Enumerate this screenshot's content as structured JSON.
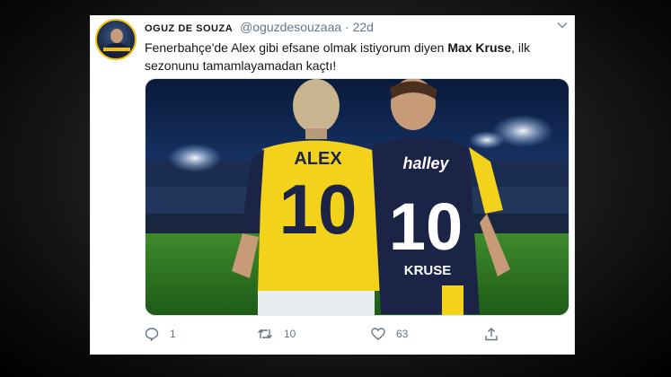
{
  "tweet": {
    "author_name": "OGUZ DE SOUZA",
    "author_handle": "@oguzdesouzaaa",
    "separator": "·",
    "time": "22d",
    "text_part1": "Fenerbahçe'de Alex gibi efsane olmak istiyorum diyen ",
    "text_bold": "Max Kruse",
    "text_part2": ", ilk sezonunu tamamlayamadan kaçtı!",
    "image": {
      "left_jersey_name": "ALEX",
      "left_jersey_number": "10",
      "right_sponsor": "halley",
      "right_jersey_number": "10",
      "right_jersey_name": "KRUSE"
    },
    "actions": {
      "replies": "1",
      "retweets": "10",
      "likes": "63"
    }
  },
  "icons": [
    "avatar",
    "chevron-down-icon",
    "reply-icon",
    "retweet-icon",
    "like-icon",
    "share-icon"
  ],
  "colors": {
    "text": "#14171a",
    "secondary": "#657786",
    "fener_yellow": "#f2d21b",
    "fener_navy": "#1b2447"
  }
}
